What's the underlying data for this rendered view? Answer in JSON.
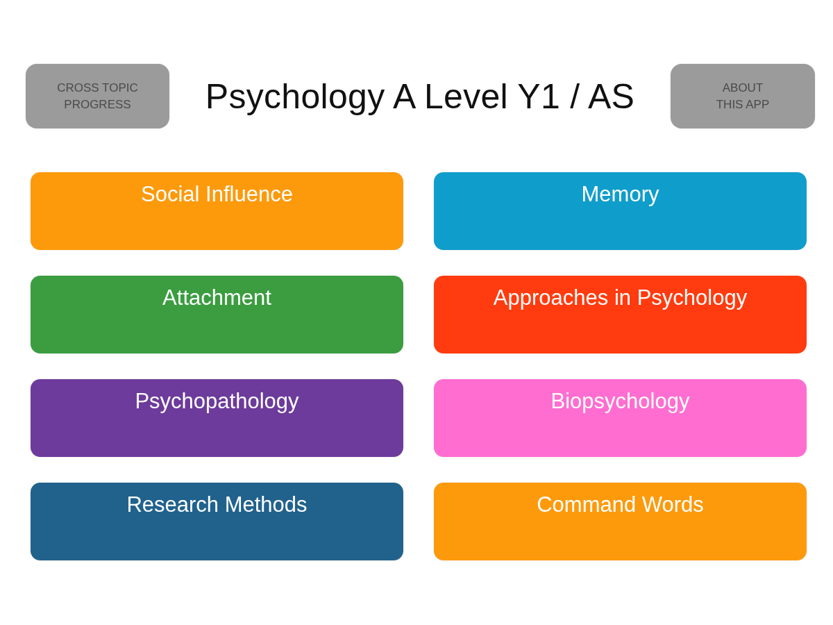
{
  "header": {
    "left_button": {
      "label": "CROSS TOPIC\nPROGRESS"
    },
    "title": "Psychology A Level Y1 / AS",
    "right_button": {
      "label": "ABOUT\nTHIS APP"
    }
  },
  "topics": [
    {
      "label": "Social Influence",
      "color": "#fc9a0c"
    },
    {
      "label": "Memory",
      "color": "#0f9dcc"
    },
    {
      "label": "Attachment",
      "color": "#3b9d3f"
    },
    {
      "label": "Approaches in Psychology",
      "color": "#ff3b0f"
    },
    {
      "label": "Psychopathology",
      "color": "#6d3b9b"
    },
    {
      "label": "Biopsychology",
      "color": "#ff6dd0"
    },
    {
      "label": "Research Methods",
      "color": "#21628d"
    },
    {
      "label": "Command Words",
      "color": "#fc9a0c"
    }
  ]
}
